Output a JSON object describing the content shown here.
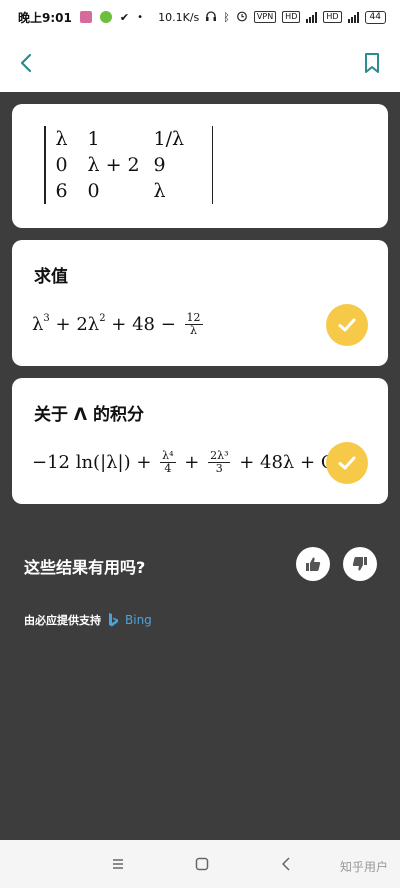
{
  "status_bar": {
    "time": "晚上9:01",
    "net_speed": "10.1K/s",
    "vpn": "VPN",
    "hd1": "HD",
    "hd2": "HD",
    "battery": "44"
  },
  "matrix": {
    "rows": [
      [
        "λ",
        "1",
        "1/λ"
      ],
      [
        "0",
        "λ + 2",
        "9"
      ],
      [
        "6",
        "0",
        "λ"
      ]
    ]
  },
  "evaluate": {
    "title": "求值",
    "expr_a": "λ",
    "exp_a": "3",
    "expr_b": " + 2λ",
    "exp_b": "2",
    "expr_c": " + 48 − ",
    "frac_num": "12",
    "frac_den": "λ"
  },
  "integral": {
    "title": "关于 Λ 的积分",
    "part1": "−12 ln(|λ|) + ",
    "frac1_num": "λ⁴",
    "frac1_den": "4",
    "plus": " + ",
    "frac2_num": "2λ³",
    "frac2_den": "3",
    "part2": " + 48λ + C"
  },
  "feedback": {
    "question": "这些结果有用吗?"
  },
  "powered_by": {
    "text": "由必应提供支持",
    "brand": "Bing"
  },
  "watermark": "知乎用户",
  "colors": {
    "accent": "#2d8c8c",
    "check_yellow": "#f7c948",
    "dark_bg": "#3d3d3d"
  },
  "icons": {
    "back": "chevron-left-icon",
    "bookmark": "bookmark-icon",
    "check": "check-icon",
    "thumbs_up": "thumbs-up-icon",
    "thumbs_down": "thumbs-down-icon"
  }
}
